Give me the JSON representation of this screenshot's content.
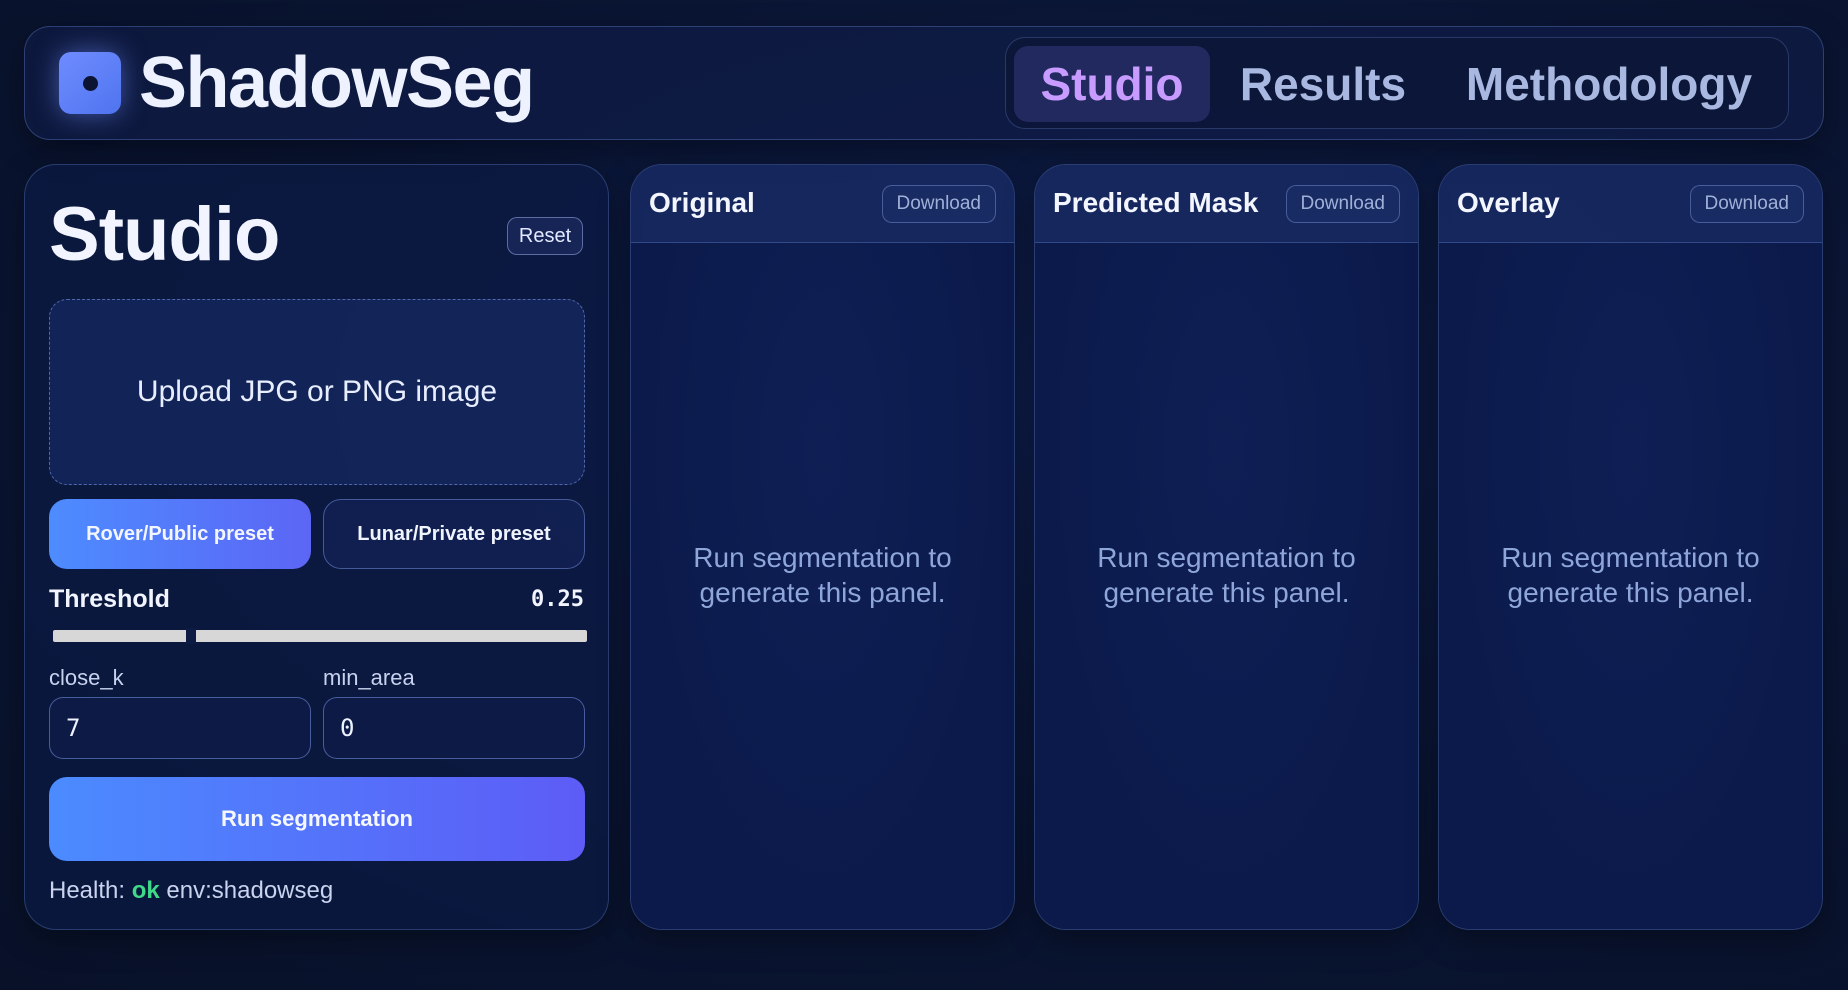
{
  "header": {
    "brand": "ShadowSeg",
    "tabs": [
      {
        "label": "Studio",
        "active": true
      },
      {
        "label": "Results",
        "active": false
      },
      {
        "label": "Methodology",
        "active": false
      }
    ]
  },
  "studio": {
    "title": "Studio",
    "reset_label": "Reset",
    "upload_label": "Upload JPG or PNG image",
    "presets": [
      "Rover/Public preset",
      "Lunar/Private preset"
    ],
    "threshold": {
      "label": "Threshold",
      "value": "0.25"
    },
    "close_k": {
      "label": "close_k",
      "value": "7"
    },
    "min_area": {
      "label": "min_area",
      "value": "0"
    },
    "run_label": "Run segmentation",
    "health": {
      "prefix": "Health:",
      "status": "ok",
      "env": "env:shadowseg"
    }
  },
  "panels": [
    {
      "title": "Original",
      "download": "Download",
      "placeholder": "Run segmentation to generate this panel."
    },
    {
      "title": "Predicted Mask",
      "download": "Download",
      "placeholder": "Run segmentation to generate this panel."
    },
    {
      "title": "Overlay",
      "download": "Download",
      "placeholder": "Run segmentation to generate this panel."
    }
  ],
  "colors": {
    "background": "#0b1533",
    "accent_active_tab": "#c79bff",
    "primary_gradient_start": "#4b8bff",
    "primary_gradient_end": "#5d5cf6",
    "health_ok": "#40d98a"
  },
  "icons": {
    "logo": "app-logo-icon"
  }
}
